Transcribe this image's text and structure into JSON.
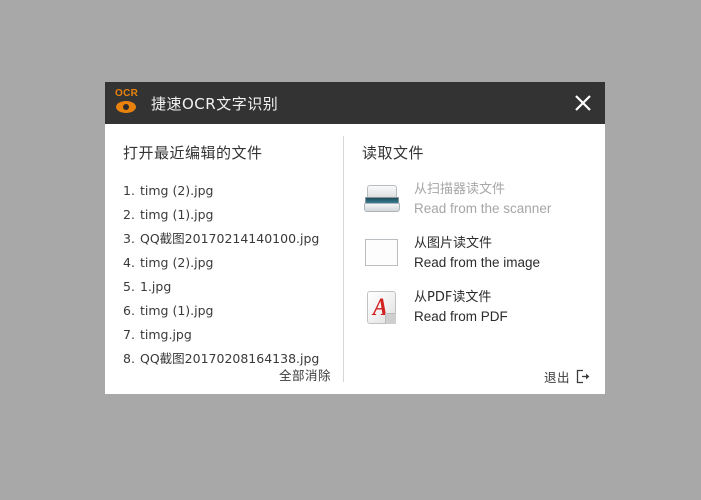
{
  "window": {
    "title": "捷速OCR文字识别",
    "logo_text": "OCR",
    "logo_icon": "ocr-eye-icon",
    "close_icon": "close-icon",
    "titlebar_color": "#333333",
    "accent_color": "#e8820c"
  },
  "left_pane": {
    "heading": "打开最近编辑的文件",
    "files": [
      {
        "index": "1.",
        "name": "timg (2).jpg"
      },
      {
        "index": "2.",
        "name": "timg (1).jpg"
      },
      {
        "index": "3.",
        "name": "QQ截图20170214140100.jpg"
      },
      {
        "index": "4.",
        "name": "timg (2).jpg"
      },
      {
        "index": "5.",
        "name": "1.jpg"
      },
      {
        "index": "6.",
        "name": "timg (1).jpg"
      },
      {
        "index": "7.",
        "name": "timg.jpg"
      },
      {
        "index": "8.",
        "name": "QQ截图20170208164138.jpg"
      }
    ],
    "clear_all_label": "全部消除"
  },
  "right_pane": {
    "heading": "读取文件",
    "sources": [
      {
        "icon": "scanner-icon",
        "cn": "从扫描器读文件",
        "en": "Read from the scanner",
        "disabled": true
      },
      {
        "icon": "image-icon",
        "cn": "从图片读文件",
        "en": "Read from the image",
        "disabled": false
      },
      {
        "icon": "pdf-icon",
        "cn": "从PDF读文件",
        "en": "Read from PDF",
        "disabled": false
      }
    ],
    "exit_label": "退出",
    "exit_icon": "exit-arrow-icon"
  }
}
